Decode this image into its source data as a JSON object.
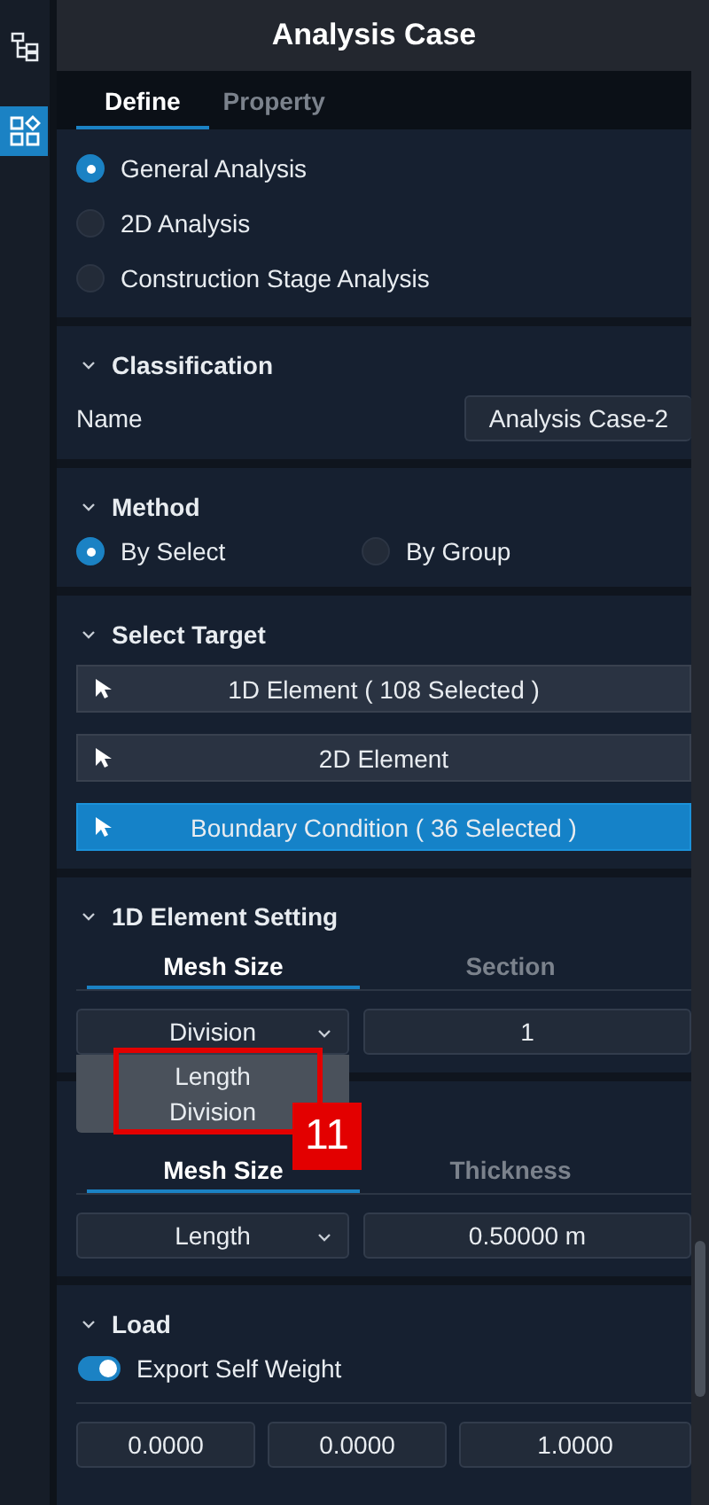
{
  "sidebar": {
    "items": [
      {
        "kind": "tree",
        "selected": false
      },
      {
        "kind": "grid",
        "selected": true
      }
    ]
  },
  "panel": {
    "title": "Analysis Case"
  },
  "tabs": [
    {
      "label": "Define",
      "selected": true
    },
    {
      "label": "Property",
      "selected": false
    }
  ],
  "analysis_types": [
    {
      "label": "General Analysis",
      "selected": true
    },
    {
      "label": "2D Analysis",
      "selected": false
    },
    {
      "label": "Construction Stage Analysis",
      "selected": false
    }
  ],
  "classification": {
    "title": "Classification",
    "name_label": "Name",
    "name_value": "Analysis Case-2"
  },
  "method": {
    "title": "Method",
    "options": [
      {
        "label": "By Select",
        "selected": true
      },
      {
        "label": "By Group",
        "selected": false
      }
    ]
  },
  "select_target": {
    "title": "Select Target",
    "buttons": [
      {
        "label": "1D Element ( 108 Selected )",
        "selected": false
      },
      {
        "label": "2D Element",
        "selected": false
      },
      {
        "label": "Boundary Condition ( 36 Selected )",
        "selected": true
      }
    ]
  },
  "element_1d": {
    "title": "1D Element Setting",
    "tabs": [
      {
        "label": "Mesh Size",
        "selected": true
      },
      {
        "label": "Section",
        "selected": false
      }
    ],
    "dropdown": {
      "value": "Division",
      "options": [
        "Length",
        "Division"
      ]
    },
    "value": "1"
  },
  "element_2d": {
    "tabs": [
      {
        "label": "Mesh Size",
        "selected": true
      },
      {
        "label": "Thickness",
        "selected": false
      }
    ],
    "dropdown": {
      "value": "Length"
    },
    "value": "0.50000 m"
  },
  "load": {
    "title": "Load",
    "toggle": {
      "label": "Export Self Weight",
      "on": true
    },
    "values": [
      "0.0000",
      "0.0000",
      "1.0000"
    ]
  },
  "annotation": {
    "label": "11"
  }
}
